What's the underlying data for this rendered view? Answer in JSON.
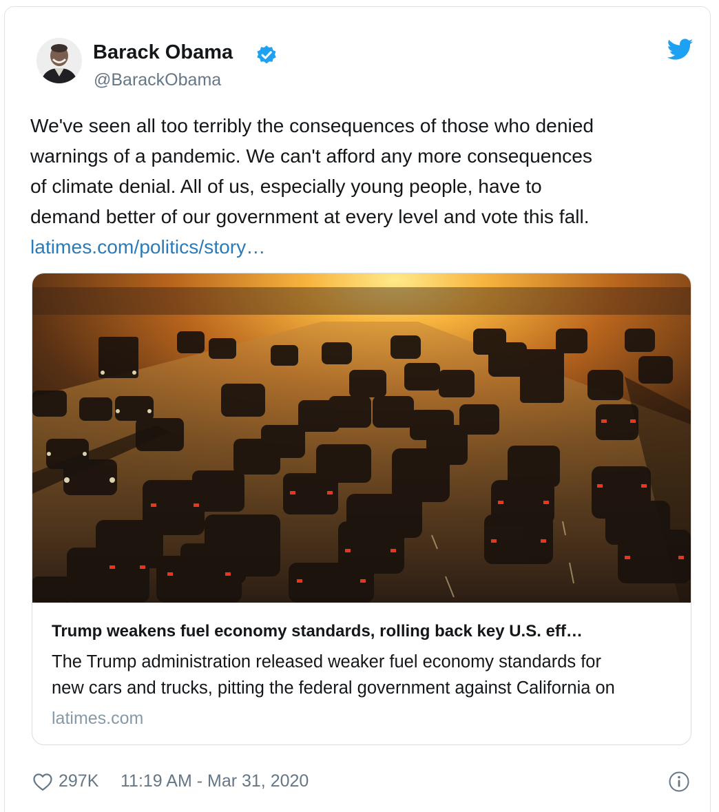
{
  "author": {
    "name": "Barack Obama",
    "handle": "@BarackObama",
    "verified_icon": "verified-badge-icon",
    "avatar": "profile-photo"
  },
  "brand_icon": "twitter-bird-icon",
  "tweet": {
    "text_lines": [
      "We've seen all too terribly the consequences of those who denied",
      "warnings of a pandemic. We can't afford any more consequences",
      "of climate denial. All of us, especially young people, have to",
      "demand better of our government at every level and vote this fall."
    ],
    "link_text": "latimes.com/politics/story…"
  },
  "link_card": {
    "image_description_icon": "freeway-traffic-photo",
    "title": "Trump weakens fuel economy standards, rolling back key U.S. eff…",
    "description_lines": [
      "The Trump administration released weaker fuel economy standards for",
      "new cars and trucks, pitting the federal government against California on"
    ],
    "domain": "latimes.com"
  },
  "footer": {
    "like_count": "297K",
    "timestamp": "11:19 AM - Mar 31, 2020",
    "info_icon": "info-icon"
  },
  "colors": {
    "text": "#14171a",
    "secondary": "#657786",
    "link": "#2b7bb9",
    "twitter_blue": "#1da1f2",
    "border": "#dfe3e7"
  }
}
